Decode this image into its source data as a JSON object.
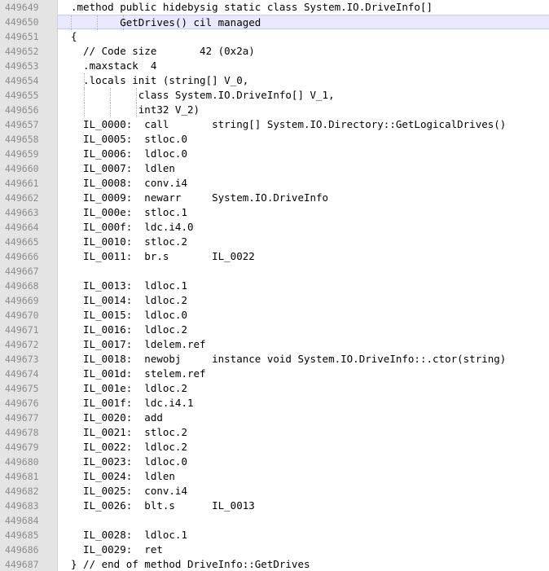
{
  "editor": {
    "lines": [
      {
        "num": "449649",
        "text": ".method public hidebysig static class System.IO.DriveInfo[]"
      },
      {
        "num": "449650",
        "text": "        GetDrives() cil managed"
      },
      {
        "num": "449651",
        "text": "{"
      },
      {
        "num": "449652",
        "text": "  // Code size       42 (0x2a)"
      },
      {
        "num": "449653",
        "text": "  .maxstack  4"
      },
      {
        "num": "449654",
        "text": "  .locals init (string[] V_0,"
      },
      {
        "num": "449655",
        "text": "           class System.IO.DriveInfo[] V_1,"
      },
      {
        "num": "449656",
        "text": "           int32 V_2)"
      },
      {
        "num": "449657",
        "text": "  IL_0000:  call       string[] System.IO.Directory::GetLogicalDrives()"
      },
      {
        "num": "449658",
        "text": "  IL_0005:  stloc.0"
      },
      {
        "num": "449659",
        "text": "  IL_0006:  ldloc.0"
      },
      {
        "num": "449660",
        "text": "  IL_0007:  ldlen"
      },
      {
        "num": "449661",
        "text": "  IL_0008:  conv.i4"
      },
      {
        "num": "449662",
        "text": "  IL_0009:  newarr     System.IO.DriveInfo"
      },
      {
        "num": "449663",
        "text": "  IL_000e:  stloc.1"
      },
      {
        "num": "449664",
        "text": "  IL_000f:  ldc.i4.0"
      },
      {
        "num": "449665",
        "text": "  IL_0010:  stloc.2"
      },
      {
        "num": "449666",
        "text": "  IL_0011:  br.s       IL_0022"
      },
      {
        "num": "449667",
        "text": ""
      },
      {
        "num": "449668",
        "text": "  IL_0013:  ldloc.1"
      },
      {
        "num": "449669",
        "text": "  IL_0014:  ldloc.2"
      },
      {
        "num": "449670",
        "text": "  IL_0015:  ldloc.0"
      },
      {
        "num": "449671",
        "text": "  IL_0016:  ldloc.2"
      },
      {
        "num": "449672",
        "text": "  IL_0017:  ldelem.ref"
      },
      {
        "num": "449673",
        "text": "  IL_0018:  newobj     instance void System.IO.DriveInfo::.ctor(string)"
      },
      {
        "num": "449674",
        "text": "  IL_001d:  stelem.ref"
      },
      {
        "num": "449675",
        "text": "  IL_001e:  ldloc.2"
      },
      {
        "num": "449676",
        "text": "  IL_001f:  ldc.i4.1"
      },
      {
        "num": "449677",
        "text": "  IL_0020:  add"
      },
      {
        "num": "449678",
        "text": "  IL_0021:  stloc.2"
      },
      {
        "num": "449679",
        "text": "  IL_0022:  ldloc.2"
      },
      {
        "num": "449680",
        "text": "  IL_0023:  ldloc.0"
      },
      {
        "num": "449681",
        "text": "  IL_0024:  ldlen"
      },
      {
        "num": "449682",
        "text": "  IL_0025:  conv.i4"
      },
      {
        "num": "449683",
        "text": "  IL_0026:  blt.s      IL_0013"
      },
      {
        "num": "449684",
        "text": ""
      },
      {
        "num": "449685",
        "text": "  IL_0028:  ldloc.1"
      },
      {
        "num": "449686",
        "text": "  IL_0029:  ret"
      },
      {
        "num": "449687",
        "text": "} // end of method DriveInfo::GetDrives"
      }
    ]
  }
}
